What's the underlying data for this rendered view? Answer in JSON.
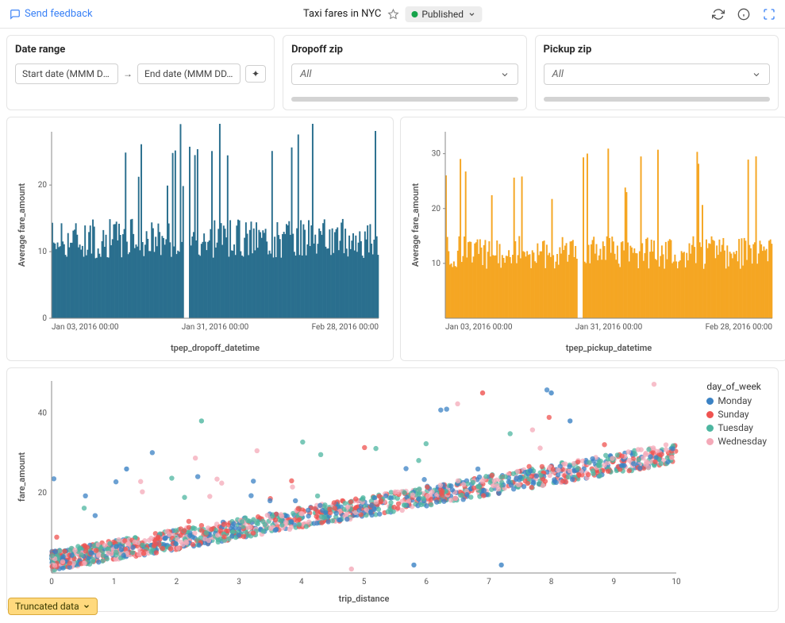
{
  "header": {
    "feedback": "Send feedback",
    "title": "Taxi fares in NYC",
    "status": "Published"
  },
  "filters": {
    "date": {
      "label": "Date range",
      "start_placeholder": "Start date (MMM DD,…",
      "end_placeholder": "End date (MMM DD, …"
    },
    "dropoff": {
      "label": "Dropoff zip",
      "value": "All"
    },
    "pickup": {
      "label": "Pickup zip",
      "value": "All"
    }
  },
  "truncated_label": "Truncated data",
  "chart_data": [
    {
      "type": "bar",
      "title": "",
      "xlabel": "tpep_dropoff_datetime",
      "ylabel": "Average fare_amount",
      "x_ticks": [
        "Jan 03, 2016 00:00",
        "Jan 31, 2016 00:00",
        "Feb 28, 2016 00:00"
      ],
      "y_ticks": [
        0,
        10,
        20
      ],
      "ylim": [
        0,
        28
      ],
      "color": "#2a6f8e",
      "note": "dense time-series bars; most values ~8–16 with spikes up to ~25–28"
    },
    {
      "type": "bar",
      "title": "",
      "xlabel": "tpep_pickup_datetime",
      "ylabel": "Average fare_amount",
      "x_ticks": [
        "Jan 03, 2016 00:00",
        "Jan 31, 2016 00:00",
        "Feb 28, 2016 00:00"
      ],
      "y_ticks": [
        10,
        20,
        30
      ],
      "ylim": [
        0,
        34
      ],
      "color": "#f5a623",
      "note": "dense time-series bars; most values ~8–16 with spikes up to ~28–34"
    },
    {
      "type": "scatter",
      "title": "",
      "xlabel": "trip_distance",
      "ylabel": "fare_amount",
      "x_ticks": [
        0,
        1,
        2,
        3,
        4,
        5,
        6,
        7,
        8,
        9,
        10
      ],
      "y_ticks": [
        20,
        40
      ],
      "xlim": [
        0,
        10
      ],
      "ylim": [
        0,
        48
      ],
      "legend_title": "day_of_week",
      "series": [
        {
          "name": "Monday",
          "color": "#3b82c4"
        },
        {
          "name": "Sunday",
          "color": "#ef5350"
        },
        {
          "name": "Tuesday",
          "color": "#4db6a0"
        },
        {
          "name": "Wednesday",
          "color": "#f4a9b8"
        }
      ],
      "note": "positive linear trend fare ≈ 3 + 2.7 × distance with spread; ~thousands of points"
    }
  ]
}
